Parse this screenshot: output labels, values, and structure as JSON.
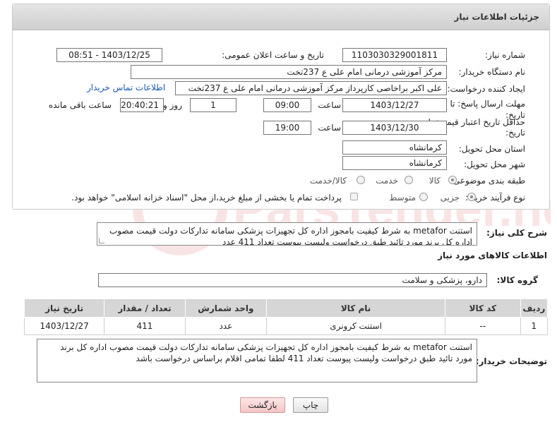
{
  "panel": {
    "title": "جزئیات اطلاعات نیاز"
  },
  "fields": {
    "need_number_label": "شماره نیاز:",
    "need_number": "1103030329001811",
    "announce_label": "تاریخ و ساعت اعلان عمومی:",
    "announce_value": "1403/12/25 - 08:51",
    "buyer_label": "نام دستگاه خریدار:",
    "buyer_value": "مرکز آموزشی درمانی امام علی ع 237تخت",
    "creator_label": "ایجاد کننده درخواست:",
    "creator_value": "علی اکبر براخاصی کارپرداز  مرکز آموزشی درمانی امام علی ع 237تخت",
    "contact_link": "اطلاعات تماس خریدار",
    "deadline_label": "مهلت ارسال پاسخ: تا",
    "deadline_label2": "تاریخ:",
    "deadline_date": "1403/12/27",
    "time_label": "ساعت",
    "deadline_time": "09:00",
    "days_value": "1",
    "days_label": "روز و",
    "remaining_time": "20:40:21",
    "remaining_label": "ساعت باقی مانده",
    "validity_label": "حداقل تاریخ اعتبار قیمت: تا",
    "validity_label2": "تاریخ:",
    "validity_date": "1403/12/30",
    "validity_time": "19:00",
    "province_label": "استان محل تحویل:",
    "province_value": "کرمانشاه",
    "city_label": "شهر محل تحویل:",
    "city_value": "کرمانشاه",
    "category_label": "طبقه بندی موضوعی:",
    "category_options": [
      "کالا",
      "خدمت",
      "کالا/خدمت"
    ],
    "purchase_label": "نوع فرآیند خرید :",
    "purchase_options": [
      "جزیی",
      "متوسط"
    ],
    "payment_note": "پرداخت تمام یا بخشی از مبلغ خرید،از محل \"اسناد خزانه اسلامی\" خواهد بود."
  },
  "description": {
    "label": "شرح کلی نیاز:",
    "text": "استنت metafor به شرط کیفیت بامجوز اداره کل تجهیزات پزشکی سامانه تدارکات دولت قیمت مصوب اداره کل برند مورد تائید طبق درخواست ولیست پیوست تعداد  411 عدد"
  },
  "goods_info": {
    "title": "اطلاعات کالاهای مورد نیاز"
  },
  "goods_group": {
    "label": "گروه کالا:",
    "value": "دارو، پزشکی و سلامت"
  },
  "table": {
    "headers": [
      "ردیف",
      "کد کالا",
      "نام کالا",
      "واحد شمارش",
      "تعداد / مقدار",
      "تاریخ نیاز"
    ],
    "rows": [
      [
        "1",
        "--",
        "استنت کرونری",
        "عدد",
        "411",
        "1403/12/27"
      ]
    ]
  },
  "buyer_notes": {
    "label": "توضیحات خریدار:",
    "text": "استنت metafor به شرط کیفیت بامجوز اداره کل تجهیزات پزشکی سامانه تدارکات دولت قیمت مصوب اداره کل برند مورد تائید طبق درخواست ولیست پیوست تعداد  411 لطفا تمامی اقلام براساس درخواست باشد"
  },
  "buttons": {
    "print": "چاپ",
    "back": "بازگشت"
  },
  "colors": {
    "link": "#1a58b5",
    "header_bg": "#d6d6d6",
    "back_button": "#f4c6c6"
  },
  "watermark": {
    "text": "ParsTender.net"
  }
}
